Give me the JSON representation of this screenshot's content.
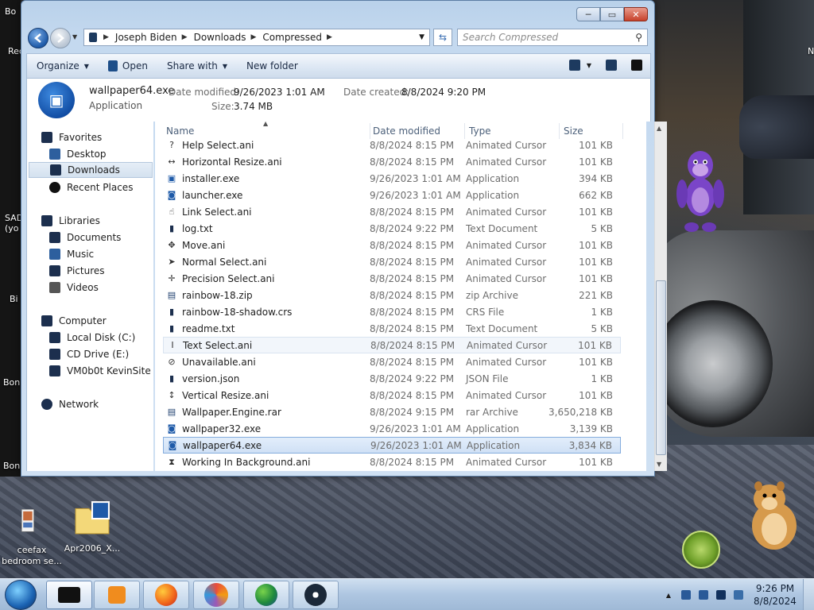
{
  "desktop": {
    "edge_labels": [
      "Bo",
      "Rec",
      "SAD (yo",
      "Bi",
      "Bon",
      "Bon"
    ],
    "right_edge_label": "N",
    "icons": [
      {
        "label_line1": "ceefax",
        "label_line2": "bedroom se..."
      },
      {
        "label_line1": "Apr2006_X...",
        "label_line2": ""
      }
    ]
  },
  "window": {
    "titlebar_buttons": {
      "minimize": "─",
      "maximize": "▭",
      "close": "✕"
    },
    "address": {
      "segments": [
        "Joseph Biden",
        "Downloads",
        "Compressed"
      ],
      "search_placeholder": "Search Compressed"
    },
    "toolbar": {
      "organize": "Organize",
      "open": "Open",
      "share_with": "Share with",
      "new_folder": "New folder"
    },
    "details": {
      "name": "wallpaper64.exe",
      "type": "Application",
      "modified_label": "Date modified:",
      "modified_value": "9/26/2023 1:01 AM",
      "created_label": "Date created:",
      "created_value": "8/8/2024 9:20 PM",
      "size_label": "Size:",
      "size_value": "3.74 MB"
    },
    "navpane": {
      "favorites": "Favorites",
      "desktop": "Desktop",
      "downloads": "Downloads",
      "recent": "Recent Places",
      "libraries": "Libraries",
      "documents": "Documents",
      "music": "Music",
      "pictures": "Pictures",
      "videos": "Videos",
      "computer": "Computer",
      "local_disk": "Local Disk (C:)",
      "cd_drive": "CD Drive (E:)",
      "vm": "VM0b0t KevinSite",
      "network": "Network"
    },
    "columns": {
      "name": "Name",
      "date": "Date modified",
      "type": "Type",
      "size": "Size"
    },
    "files": [
      {
        "name": "Help Select.ani",
        "date": "8/8/2024 8:15 PM",
        "type": "Animated Cursor",
        "size": "101 KB",
        "icon": "?"
      },
      {
        "name": "Horizontal Resize.ani",
        "date": "8/8/2024 8:15 PM",
        "type": "Animated Cursor",
        "size": "101 KB",
        "icon": "↔"
      },
      {
        "name": "installer.exe",
        "date": "9/26/2023 1:01 AM",
        "type": "Application",
        "size": "394 KB",
        "icon": "▣"
      },
      {
        "name": "launcher.exe",
        "date": "9/26/2023 1:01 AM",
        "type": "Application",
        "size": "662 KB",
        "icon": "◙"
      },
      {
        "name": "Link Select.ani",
        "date": "8/8/2024 8:15 PM",
        "type": "Animated Cursor",
        "size": "101 KB",
        "icon": "☝"
      },
      {
        "name": "log.txt",
        "date": "8/8/2024 9:22 PM",
        "type": "Text Document",
        "size": "5 KB",
        "icon": "▮"
      },
      {
        "name": "Move.ani",
        "date": "8/8/2024 8:15 PM",
        "type": "Animated Cursor",
        "size": "101 KB",
        "icon": "✥"
      },
      {
        "name": "Normal Select.ani",
        "date": "8/8/2024 8:15 PM",
        "type": "Animated Cursor",
        "size": "101 KB",
        "icon": "➤"
      },
      {
        "name": "Precision Select.ani",
        "date": "8/8/2024 8:15 PM",
        "type": "Animated Cursor",
        "size": "101 KB",
        "icon": "✛"
      },
      {
        "name": "rainbow-18.zip",
        "date": "8/8/2024 8:15 PM",
        "type": "zip Archive",
        "size": "221 KB",
        "icon": "▤"
      },
      {
        "name": "rainbow-18-shadow.crs",
        "date": "8/8/2024 8:15 PM",
        "type": "CRS File",
        "size": "1 KB",
        "icon": "▮"
      },
      {
        "name": "readme.txt",
        "date": "8/8/2024 8:15 PM",
        "type": "Text Document",
        "size": "5 KB",
        "icon": "▮"
      },
      {
        "name": "Text Select.ani",
        "date": "8/8/2024 8:15 PM",
        "type": "Animated Cursor",
        "size": "101 KB",
        "icon": "I"
      },
      {
        "name": "Unavailable.ani",
        "date": "8/8/2024 8:15 PM",
        "type": "Animated Cursor",
        "size": "101 KB",
        "icon": "⊘"
      },
      {
        "name": "version.json",
        "date": "8/8/2024 9:22 PM",
        "type": "JSON File",
        "size": "1 KB",
        "icon": "▮"
      },
      {
        "name": "Vertical Resize.ani",
        "date": "8/8/2024 8:15 PM",
        "type": "Animated Cursor",
        "size": "101 KB",
        "icon": "↕"
      },
      {
        "name": "Wallpaper.Engine.rar",
        "date": "8/8/2024 9:15 PM",
        "type": "rar Archive",
        "size": "3,650,218 KB",
        "icon": "▤"
      },
      {
        "name": "wallpaper32.exe",
        "date": "9/26/2023 1:01 AM",
        "type": "Application",
        "size": "3,139 KB",
        "icon": "◙"
      },
      {
        "name": "wallpaper64.exe",
        "date": "9/26/2023 1:01 AM",
        "type": "Application",
        "size": "3,834 KB",
        "icon": "◙"
      },
      {
        "name": "Working In Background.ani",
        "date": "8/8/2024 8:15 PM",
        "type": "Animated Cursor",
        "size": "101 KB",
        "icon": "⧗"
      }
    ]
  },
  "taskbar": {
    "time": "9:26 PM",
    "date": "8/8/2024"
  },
  "colors": {
    "accent": "#1e5aa8",
    "selection": "#cfe0f5"
  }
}
